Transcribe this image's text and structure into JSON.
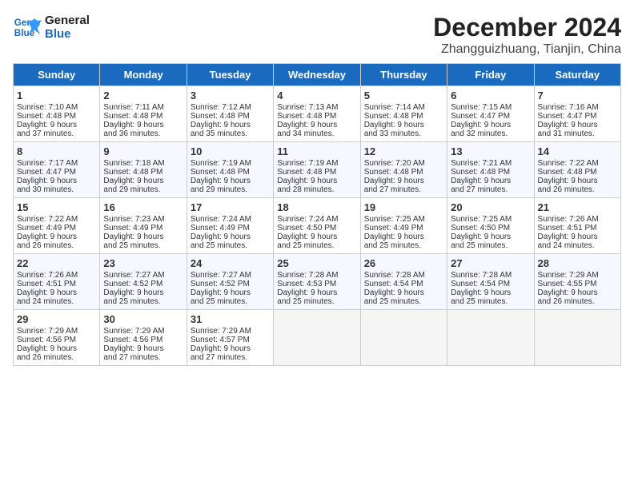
{
  "header": {
    "logo_line1": "General",
    "logo_line2": "Blue",
    "month": "December 2024",
    "location": "Zhangguizhuang, Tianjin, China"
  },
  "days_of_week": [
    "Sunday",
    "Monday",
    "Tuesday",
    "Wednesday",
    "Thursday",
    "Friday",
    "Saturday"
  ],
  "weeks": [
    [
      {
        "day": "1",
        "info": "Sunrise: 7:10 AM\nSunset: 4:48 PM\nDaylight: 9 hours\nand 37 minutes."
      },
      {
        "day": "2",
        "info": "Sunrise: 7:11 AM\nSunset: 4:48 PM\nDaylight: 9 hours\nand 36 minutes."
      },
      {
        "day": "3",
        "info": "Sunrise: 7:12 AM\nSunset: 4:48 PM\nDaylight: 9 hours\nand 35 minutes."
      },
      {
        "day": "4",
        "info": "Sunrise: 7:13 AM\nSunset: 4:48 PM\nDaylight: 9 hours\nand 34 minutes."
      },
      {
        "day": "5",
        "info": "Sunrise: 7:14 AM\nSunset: 4:48 PM\nDaylight: 9 hours\nand 33 minutes."
      },
      {
        "day": "6",
        "info": "Sunrise: 7:15 AM\nSunset: 4:47 PM\nDaylight: 9 hours\nand 32 minutes."
      },
      {
        "day": "7",
        "info": "Sunrise: 7:16 AM\nSunset: 4:47 PM\nDaylight: 9 hours\nand 31 minutes."
      }
    ],
    [
      {
        "day": "8",
        "info": "Sunrise: 7:17 AM\nSunset: 4:47 PM\nDaylight: 9 hours\nand 30 minutes."
      },
      {
        "day": "9",
        "info": "Sunrise: 7:18 AM\nSunset: 4:48 PM\nDaylight: 9 hours\nand 29 minutes."
      },
      {
        "day": "10",
        "info": "Sunrise: 7:19 AM\nSunset: 4:48 PM\nDaylight: 9 hours\nand 29 minutes."
      },
      {
        "day": "11",
        "info": "Sunrise: 7:19 AM\nSunset: 4:48 PM\nDaylight: 9 hours\nand 28 minutes."
      },
      {
        "day": "12",
        "info": "Sunrise: 7:20 AM\nSunset: 4:48 PM\nDaylight: 9 hours\nand 27 minutes."
      },
      {
        "day": "13",
        "info": "Sunrise: 7:21 AM\nSunset: 4:48 PM\nDaylight: 9 hours\nand 27 minutes."
      },
      {
        "day": "14",
        "info": "Sunrise: 7:22 AM\nSunset: 4:48 PM\nDaylight: 9 hours\nand 26 minutes."
      }
    ],
    [
      {
        "day": "15",
        "info": "Sunrise: 7:22 AM\nSunset: 4:49 PM\nDaylight: 9 hours\nand 26 minutes."
      },
      {
        "day": "16",
        "info": "Sunrise: 7:23 AM\nSunset: 4:49 PM\nDaylight: 9 hours\nand 25 minutes."
      },
      {
        "day": "17",
        "info": "Sunrise: 7:24 AM\nSunset: 4:49 PM\nDaylight: 9 hours\nand 25 minutes."
      },
      {
        "day": "18",
        "info": "Sunrise: 7:24 AM\nSunset: 4:50 PM\nDaylight: 9 hours\nand 25 minutes."
      },
      {
        "day": "19",
        "info": "Sunrise: 7:25 AM\nSunset: 4:49 PM\nDaylight: 9 hours\nand 25 minutes."
      },
      {
        "day": "20",
        "info": "Sunrise: 7:25 AM\nSunset: 4:50 PM\nDaylight: 9 hours\nand 25 minutes."
      },
      {
        "day": "21",
        "info": "Sunrise: 7:26 AM\nSunset: 4:51 PM\nDaylight: 9 hours\nand 24 minutes."
      }
    ],
    [
      {
        "day": "22",
        "info": "Sunrise: 7:26 AM\nSunset: 4:51 PM\nDaylight: 9 hours\nand 24 minutes."
      },
      {
        "day": "23",
        "info": "Sunrise: 7:27 AM\nSunset: 4:52 PM\nDaylight: 9 hours\nand 25 minutes."
      },
      {
        "day": "24",
        "info": "Sunrise: 7:27 AM\nSunset: 4:52 PM\nDaylight: 9 hours\nand 25 minutes."
      },
      {
        "day": "25",
        "info": "Sunrise: 7:28 AM\nSunset: 4:53 PM\nDaylight: 9 hours\nand 25 minutes."
      },
      {
        "day": "26",
        "info": "Sunrise: 7:28 AM\nSunset: 4:54 PM\nDaylight: 9 hours\nand 25 minutes."
      },
      {
        "day": "27",
        "info": "Sunrise: 7:28 AM\nSunset: 4:54 PM\nDaylight: 9 hours\nand 25 minutes."
      },
      {
        "day": "28",
        "info": "Sunrise: 7:29 AM\nSunset: 4:55 PM\nDaylight: 9 hours\nand 26 minutes."
      }
    ],
    [
      {
        "day": "29",
        "info": "Sunrise: 7:29 AM\nSunset: 4:56 PM\nDaylight: 9 hours\nand 26 minutes."
      },
      {
        "day": "30",
        "info": "Sunrise: 7:29 AM\nSunset: 4:56 PM\nDaylight: 9 hours\nand 27 minutes."
      },
      {
        "day": "31",
        "info": "Sunrise: 7:29 AM\nSunset: 4:57 PM\nDaylight: 9 hours\nand 27 minutes."
      },
      {
        "day": "",
        "info": ""
      },
      {
        "day": "",
        "info": ""
      },
      {
        "day": "",
        "info": ""
      },
      {
        "day": "",
        "info": ""
      }
    ]
  ]
}
